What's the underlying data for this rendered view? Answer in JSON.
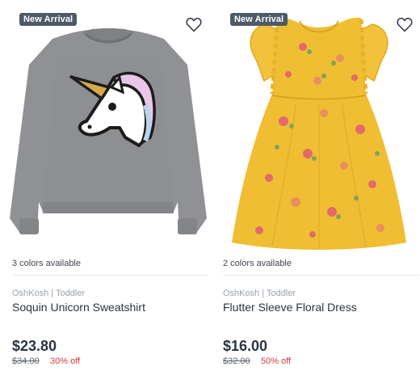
{
  "products": [
    {
      "badge": "New Arrival",
      "colors_text": "3 colors available",
      "brand": "OshKosh | Toddler",
      "title": "Soquin Unicorn Sweatshirt",
      "price": "$23.80",
      "was_price": "$34.00",
      "discount": "30% off",
      "image_icon": "gray-unicorn-sweatshirt-image",
      "image_colors": {
        "main": "#8f9194",
        "accent": "#1c1c1c"
      }
    },
    {
      "badge": "New Arrival",
      "colors_text": "2 colors available",
      "brand": "OshKosh | Toddler",
      "title": "Flutter Sleeve Floral Dress",
      "price": "$16.00",
      "was_price": "$32.00",
      "discount": "50% off",
      "image_icon": "yellow-floral-dress-image",
      "image_colors": {
        "main": "#f0be33",
        "accent": "#e26a6a"
      }
    }
  ],
  "colors": {
    "badge_bg": "#4d5a68",
    "sale_red": "#d73a3a",
    "text_dark": "#2c3440",
    "text_muted": "#9aa1a9"
  }
}
